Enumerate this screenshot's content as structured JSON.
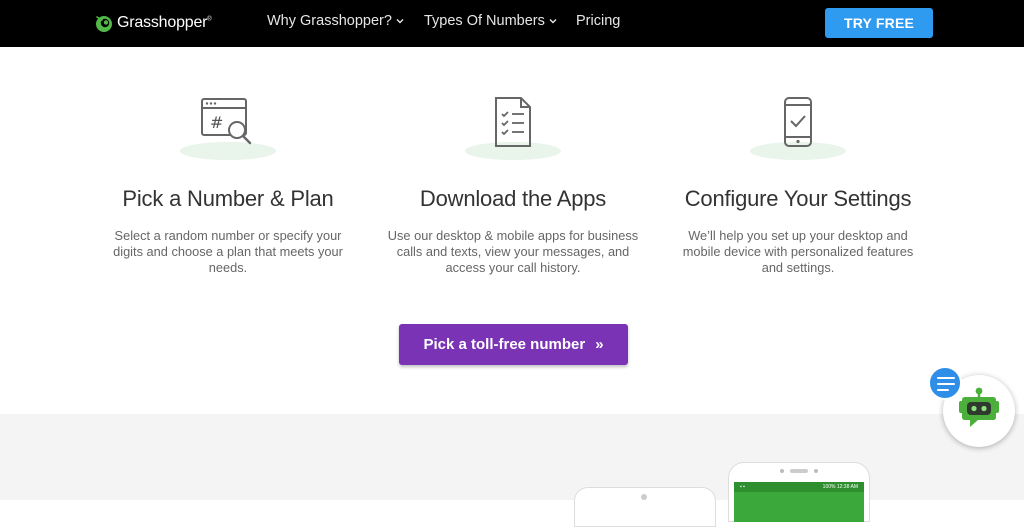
{
  "header": {
    "logo_text": "Grasshopper",
    "logo_mark": "®",
    "nav": [
      {
        "label": "Why Grasshopper?",
        "dropdown": true
      },
      {
        "label": "Types Of Numbers",
        "dropdown": true
      },
      {
        "label": "Pricing",
        "dropdown": false
      }
    ],
    "cta_label": "TRY FREE"
  },
  "features": [
    {
      "icon": "number-search-icon",
      "title": "Pick a Number & Plan",
      "description": "Select a random number or specify your digits and choose a plan that meets your needs."
    },
    {
      "icon": "checklist-document-icon",
      "title": "Download the Apps",
      "description": "Use our desktop & mobile apps for business calls and texts, view your messages, and access your call history."
    },
    {
      "icon": "phone-check-icon",
      "title": "Configure Your Settings",
      "description": "We’ll help you set up your desktop and mobile device with personalized features and settings."
    }
  ],
  "cta": {
    "label": "Pick a toll-free number",
    "arrow": "»"
  },
  "phone_status": {
    "time": "12:38 AM",
    "battery": "100%"
  },
  "colors": {
    "header_bg": "#000000",
    "try_free_bg": "#2f9bf0",
    "cta_bg": "#7a33b5",
    "brand_green": "#3aa83a",
    "grey_section": "#f4f4f4"
  }
}
